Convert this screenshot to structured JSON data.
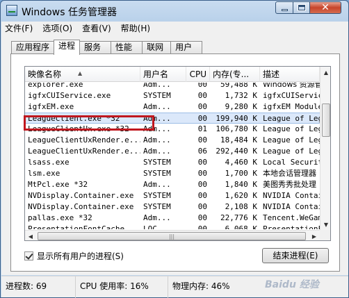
{
  "window": {
    "title": "Windows 任务管理器"
  },
  "menu": [
    "文件(F)",
    "选项(O)",
    "查看(V)",
    "帮助(H)"
  ],
  "tabs": [
    "应用程序",
    "进程",
    "服务",
    "性能",
    "联网",
    "用户"
  ],
  "active_tab": "进程",
  "columns": {
    "name": "映像名称",
    "user": "用户名",
    "cpu": "CPU",
    "mem": "内存(专...",
    "desc": "描述"
  },
  "rows": [
    {
      "name": "explorer.exe",
      "user": "Adm...",
      "cpu": "00",
      "mem": "59,488 K",
      "desc": "Windows 资源管"
    },
    {
      "name": "igfxCUIService.exe",
      "user": "SYSTEM",
      "cpu": "00",
      "mem": "1,732 K",
      "desc": "igfxCUIServic"
    },
    {
      "name": "igfxEM.exe",
      "user": "Adm...",
      "cpu": "00",
      "mem": "9,280 K",
      "desc": "igfxEM Module"
    },
    {
      "name": "LeagueClient.exe *32",
      "user": "Adm...",
      "cpu": "00",
      "mem": "199,940 K",
      "desc": "League of Leg",
      "selected": true
    },
    {
      "name": "LeagueClientUx.exe *32",
      "user": "Adm...",
      "cpu": "01",
      "mem": "106,780 K",
      "desc": "League of Leg"
    },
    {
      "name": "LeagueClientUxRender.e...",
      "user": "Adm...",
      "cpu": "00",
      "mem": "18,484 K",
      "desc": "League of Leg"
    },
    {
      "name": "LeagueClientUxRender.e...",
      "user": "Adm...",
      "cpu": "06",
      "mem": "292,440 K",
      "desc": "League of Leg"
    },
    {
      "name": "lsass.exe",
      "user": "SYSTEM",
      "cpu": "00",
      "mem": "4,460 K",
      "desc": "Local Securit"
    },
    {
      "name": "lsm.exe",
      "user": "SYSTEM",
      "cpu": "00",
      "mem": "1,700 K",
      "desc": "本地会话管理器"
    },
    {
      "name": "MtPcl.exe *32",
      "user": "Adm...",
      "cpu": "00",
      "mem": "1,840 K",
      "desc": "美图秀秀批处理"
    },
    {
      "name": "NVDisplay.Container.exe",
      "user": "SYSTEM",
      "cpu": "00",
      "mem": "1,620 K",
      "desc": "NVIDIA Contai"
    },
    {
      "name": "NVDisplay.Container.exe",
      "user": "SYSTEM",
      "cpu": "00",
      "mem": "2,108 K",
      "desc": "NVIDIA Contai"
    },
    {
      "name": "pallas.exe *32",
      "user": "Adm...",
      "cpu": "00",
      "mem": "22,776 K",
      "desc": "Tencent.WeGam"
    },
    {
      "name": "PresentationFontCache...",
      "user": "LOC...",
      "cpu": "00",
      "mem": "6,068 K",
      "desc": "PresentationF"
    }
  ],
  "show_all_label": "显示所有用户的进程(S)",
  "show_all_checked": true,
  "end_process_label": "结束进程(E)",
  "status": {
    "processes": "进程数: 69",
    "cpu": "CPU 使用率: 16%",
    "memory": "物理内存: 46%"
  },
  "watermark": "Baidu 经验"
}
